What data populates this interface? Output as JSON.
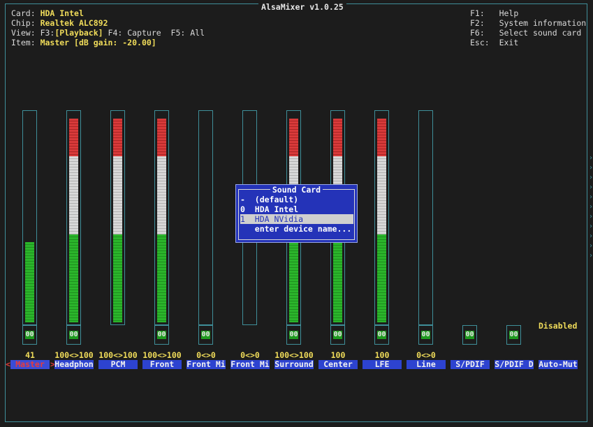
{
  "window": {
    "title": "AlsaMixer v1.0.25"
  },
  "info": {
    "card_key": "Card:",
    "card_value": "HDA Intel",
    "chip_key": "Chip:",
    "chip_value": "Realtek ALC892",
    "view_key": "View:",
    "view_f3": "F3:",
    "view_playback": "[Playback]",
    "view_f4": " F4: Capture  F5: All",
    "item_key": "Item:",
    "item_value": "Master [dB gain: -20.00]"
  },
  "help": [
    {
      "key": "F1:",
      "label": "Help"
    },
    {
      "key": "F2:",
      "label": "System information"
    },
    {
      "key": "F6:",
      "label": "Select sound card"
    },
    {
      "key": "Esc:",
      "label": "Exit"
    }
  ],
  "channels": [
    {
      "label": "Master",
      "value": "41",
      "mute": "00",
      "level": 0.41,
      "active": true
    },
    {
      "label": "Headphon",
      "value": "100<>100",
      "mute": "00",
      "level": 1.0
    },
    {
      "label": "PCM",
      "value": "100<>100",
      "mute": "",
      "level": 1.0
    },
    {
      "label": "Front",
      "value": "100<>100",
      "mute": "00",
      "level": 1.0
    },
    {
      "label": "Front Mi",
      "value": "0<>0",
      "mute": "00",
      "level": 0
    },
    {
      "label": "Front Mi",
      "value": "0<>0",
      "mute": "",
      "level": 0
    },
    {
      "label": "Surround",
      "value": "100<>100",
      "mute": "00",
      "level": 1.0
    },
    {
      "label": "Center",
      "value": "100",
      "mute": "00",
      "level": 1.0
    },
    {
      "label": "LFE",
      "value": "100",
      "mute": "00",
      "level": 1.0
    },
    {
      "label": "Line",
      "value": "0<>0",
      "mute": "00",
      "level": 0
    },
    {
      "label": "S/PDIF",
      "value": "",
      "mute": "00",
      "level": null
    },
    {
      "label": "S/PDIF D",
      "value": "",
      "mute": "00",
      "level": null
    },
    {
      "label": "Auto-Mut",
      "value": "",
      "mute": "",
      "level": null
    }
  ],
  "left_arrow": "<",
  "right_arrow": ">",
  "disabled_text": "Disabled",
  "dialog": {
    "title": "Sound Card",
    "items": [
      {
        "text": "-  (default)",
        "highlighted": false
      },
      {
        "text": "0  HDA Intel",
        "highlighted": false
      },
      {
        "text": "1  HDA NVidia",
        "highlighted": true
      },
      {
        "text": "   enter device name...",
        "highlighted": false
      }
    ]
  },
  "colors": {
    "border": "#3f8f9a",
    "accent": "#f0dc5a",
    "dialog_bg": "#2433b8",
    "label_bg": "#2d43d0",
    "green": "#2bb52b",
    "red": "#d83a3a"
  }
}
